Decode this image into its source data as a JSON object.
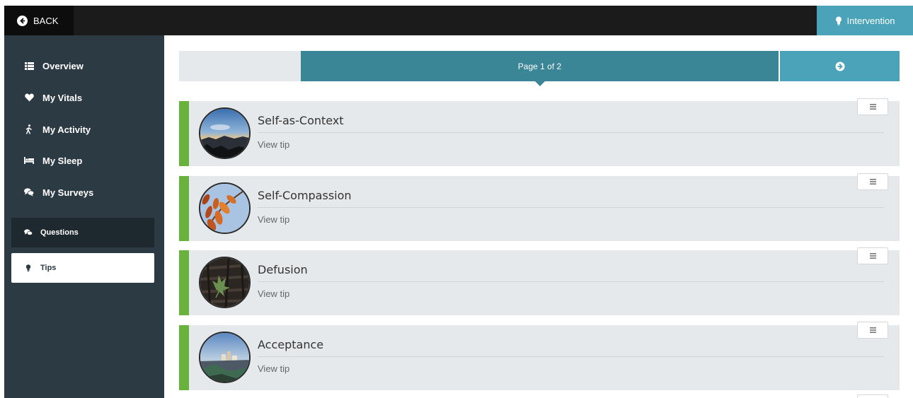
{
  "topbar": {
    "back_label": "BACK",
    "intervention_label": "Intervention"
  },
  "sidebar": {
    "items": [
      {
        "label": "Overview",
        "icon": "list-icon"
      },
      {
        "label": "My Vitals",
        "icon": "heart-icon"
      },
      {
        "label": "My Activity",
        "icon": "walking-icon"
      },
      {
        "label": "My Sleep",
        "icon": "bed-icon"
      },
      {
        "label": "My Surveys",
        "icon": "chat-icon"
      }
    ],
    "sub_items": [
      {
        "label": "Questions",
        "icon": "chat-icon",
        "active": false
      },
      {
        "label": "Tips",
        "icon": "lightbulb-icon",
        "active": true
      }
    ]
  },
  "pager": {
    "label": "Page 1 of 2"
  },
  "tips": [
    {
      "title": "Self-as-Context",
      "link": "View tip",
      "image": "sunset-landscape"
    },
    {
      "title": "Self-Compassion",
      "link": "View tip",
      "image": "autumn-leaves"
    },
    {
      "title": "Defusion",
      "link": "View tip",
      "image": "leaf-on-bark"
    },
    {
      "title": "Acceptance",
      "link": "View tip",
      "image": "coastal-town"
    }
  ],
  "colors": {
    "accent": "#4aa3b8",
    "pager": "#3a8596",
    "sidebar": "#2c3a43",
    "tip_marker": "#6ab23e"
  }
}
